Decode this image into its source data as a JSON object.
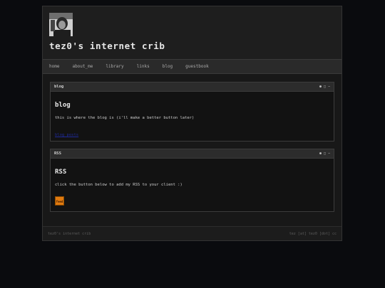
{
  "site": {
    "title": "tez0's internet crib"
  },
  "nav": {
    "items": [
      "home",
      "about_me",
      "library",
      "links",
      "blog",
      "guestbook"
    ]
  },
  "blog_window": {
    "title": "blog",
    "controls": [
      "●",
      "□",
      "−"
    ],
    "heading": "blog",
    "text": "this is where the blog is (i'll make a better button later)",
    "link": "blog posts"
  },
  "rss_window": {
    "title": "RSS",
    "controls": [
      "●",
      "□",
      "−"
    ],
    "heading": "RSS",
    "text": "click the button below to add my RSS to your client :)",
    "button_label": "feed"
  },
  "footer": {
    "left": "tez0's internet crib",
    "right": "tez [at] tez0 [dot] cc"
  },
  "colors": {
    "background": "#0a0b0e",
    "panel": "#1c1c1c",
    "rss": "#e07a10",
    "link": "#1f2a9a"
  }
}
